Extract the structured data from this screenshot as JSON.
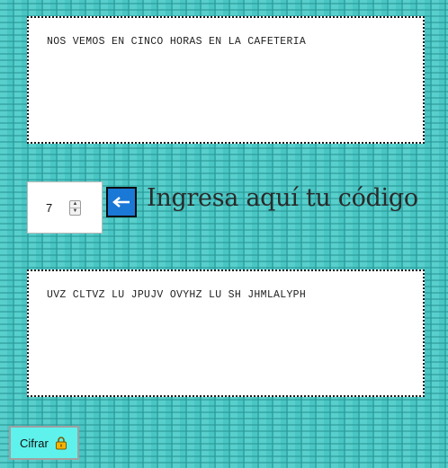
{
  "input": {
    "text": "NOS VEMOS EN CINCO HORAS EN LA CAFETERIA"
  },
  "shift": {
    "value": "7"
  },
  "heading": {
    "text": "Ingresa aquí tu código"
  },
  "output": {
    "text": "UVZ CLTVZ LU JPUJV OVYHZ LU SH JHMLALYPH"
  },
  "cipher_button": {
    "label": "Cifrar",
    "icon": "lock-icon"
  },
  "arrow_button": {
    "icon": "arrow-left-icon",
    "color": "#1a78d6"
  },
  "colors": {
    "background": "#3dbfbd",
    "button": "#5ff2ec"
  }
}
